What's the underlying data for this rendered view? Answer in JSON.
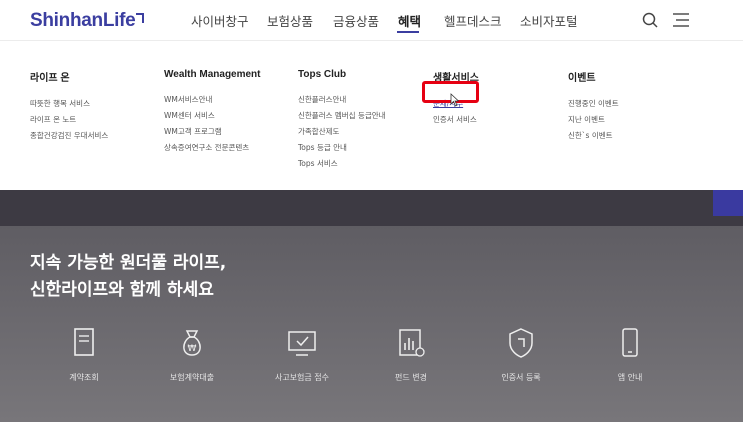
{
  "header": {
    "logo": "ShinhanLife",
    "nav": [
      "사이버창구",
      "보험상품",
      "금융상품",
      "혜택",
      "헬프데스크",
      "소비자포털"
    ],
    "active_nav": "혜택",
    "icons": [
      "search-icon",
      "menu-icon"
    ]
  },
  "menu": {
    "columns": [
      {
        "title": "라이프 온",
        "items": [
          "따뜻한 행복 서비스",
          "라이프 온 노트",
          "종합건강검진 우대서비스"
        ]
      },
      {
        "title": "Wealth Management",
        "items": [
          "WM서비스안내",
          "WM센터 서비스",
          "WM고객 프로그램",
          "상속증여연구소 전문콘텐츠"
        ]
      },
      {
        "title": "Tops Club",
        "items": [
          "신한플러스안내",
          "신한플러스 멤버십 등급안내",
          "가족합산제도",
          "Tops 등급 안내",
          "Tops 서비스"
        ]
      },
      {
        "title": "생활서비스",
        "items": [
          "운세/사주",
          "인증서 서비스"
        ]
      },
      {
        "title": "이벤트",
        "items": [
          "진행중인 이벤트",
          "지난 이벤트",
          "신한`s 이벤트"
        ]
      }
    ],
    "highlighted_item": "운세/사주"
  },
  "main": {
    "headline_line1": "지속 가능한 원더풀 라이프,",
    "headline_line2": "신한라이프와 함께 하세요",
    "quick_links": [
      {
        "label": "계약조회",
        "icon": "document-icon"
      },
      {
        "label": "보험계약대출",
        "icon": "money-bag-icon"
      },
      {
        "label": "사고보험금 접수",
        "icon": "monitor-check-icon"
      },
      {
        "label": "펀드 변경",
        "icon": "chart-icon"
      },
      {
        "label": "인증서 등록",
        "icon": "shield-icon"
      },
      {
        "label": "앱 안내",
        "icon": "smartphone-icon"
      }
    ]
  },
  "colors": {
    "brand": "#3b3ea0",
    "highlight_box": "#e60012"
  }
}
